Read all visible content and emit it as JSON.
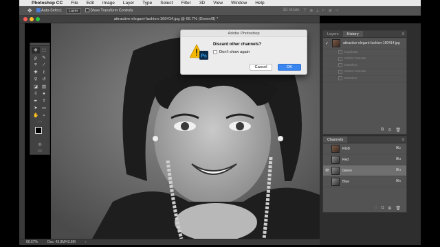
{
  "menubar": {
    "app_name": "Photoshop CC",
    "items": [
      "File",
      "Edit",
      "Image",
      "Layer",
      "Type",
      "Select",
      "Filter",
      "3D",
      "View",
      "Window",
      "Help"
    ]
  },
  "options_bar": {
    "auto_select_label": "Auto-Select:",
    "auto_select_value": "Layer",
    "show_transform_label": "Show Transform Controls",
    "mode_label": "3D Mode:"
  },
  "document": {
    "title": "attractive-elegant-fashion-160414.jpg @ 66.7% (Green/8) *"
  },
  "toolbar": {
    "tools": [
      {
        "name": "move-tool-icon",
        "glyph": "✥"
      },
      {
        "name": "marquee-tool-icon",
        "glyph": "⬚"
      },
      {
        "name": "lasso-tool-icon",
        "glyph": "ϼ"
      },
      {
        "name": "quick-select-tool-icon",
        "glyph": "✎"
      },
      {
        "name": "crop-tool-icon",
        "glyph": "⌗"
      },
      {
        "name": "eyedropper-tool-icon",
        "glyph": "⁄"
      },
      {
        "name": "healing-brush-tool-icon",
        "glyph": "✚"
      },
      {
        "name": "brush-tool-icon",
        "glyph": "ℓ"
      },
      {
        "name": "clone-stamp-tool-icon",
        "glyph": "⚲"
      },
      {
        "name": "history-brush-tool-icon",
        "glyph": "↺"
      },
      {
        "name": "eraser-tool-icon",
        "glyph": "◪"
      },
      {
        "name": "gradient-tool-icon",
        "glyph": "▥"
      },
      {
        "name": "blur-tool-icon",
        "glyph": "◊"
      },
      {
        "name": "dodge-tool-icon",
        "glyph": "●"
      },
      {
        "name": "pen-tool-icon",
        "glyph": "✒"
      },
      {
        "name": "type-tool-icon",
        "glyph": "T"
      },
      {
        "name": "path-select-tool-icon",
        "glyph": "➤"
      },
      {
        "name": "shape-tool-icon",
        "glyph": "▭"
      },
      {
        "name": "hand-tool-icon",
        "glyph": "✋"
      },
      {
        "name": "zoom-tool-icon",
        "glyph": "⌕"
      }
    ],
    "more": "···"
  },
  "history_panel": {
    "tabs": [
      "Layers",
      "History"
    ],
    "active_tab": "History",
    "snapshot": "attractive-elegant-fashion-160414.jpg",
    "steps": [
      "Duplicate",
      "Select Canvas",
      "Deselect",
      "Select Canvas",
      "Deselect"
    ]
  },
  "channels_panel": {
    "tab": "Channels",
    "channels": [
      {
        "name": "RGB",
        "shortcut": "⌘2",
        "visible": false,
        "selected": false
      },
      {
        "name": "Red",
        "shortcut": "⌘3",
        "visible": false,
        "selected": false
      },
      {
        "name": "Green",
        "shortcut": "⌘4",
        "visible": true,
        "selected": true
      },
      {
        "name": "Blue",
        "shortcut": "⌘5",
        "visible": false,
        "selected": false
      }
    ]
  },
  "dialog": {
    "title": "Adobe Photoshop",
    "message": "Discard other channels?",
    "checkbox_label": "Don't show again",
    "cancel_label": "Cancel",
    "ok_label": "OK"
  },
  "statusbar": {
    "zoom": "66.67%",
    "doc_info": "Doc: 43.8M/43.8M"
  }
}
